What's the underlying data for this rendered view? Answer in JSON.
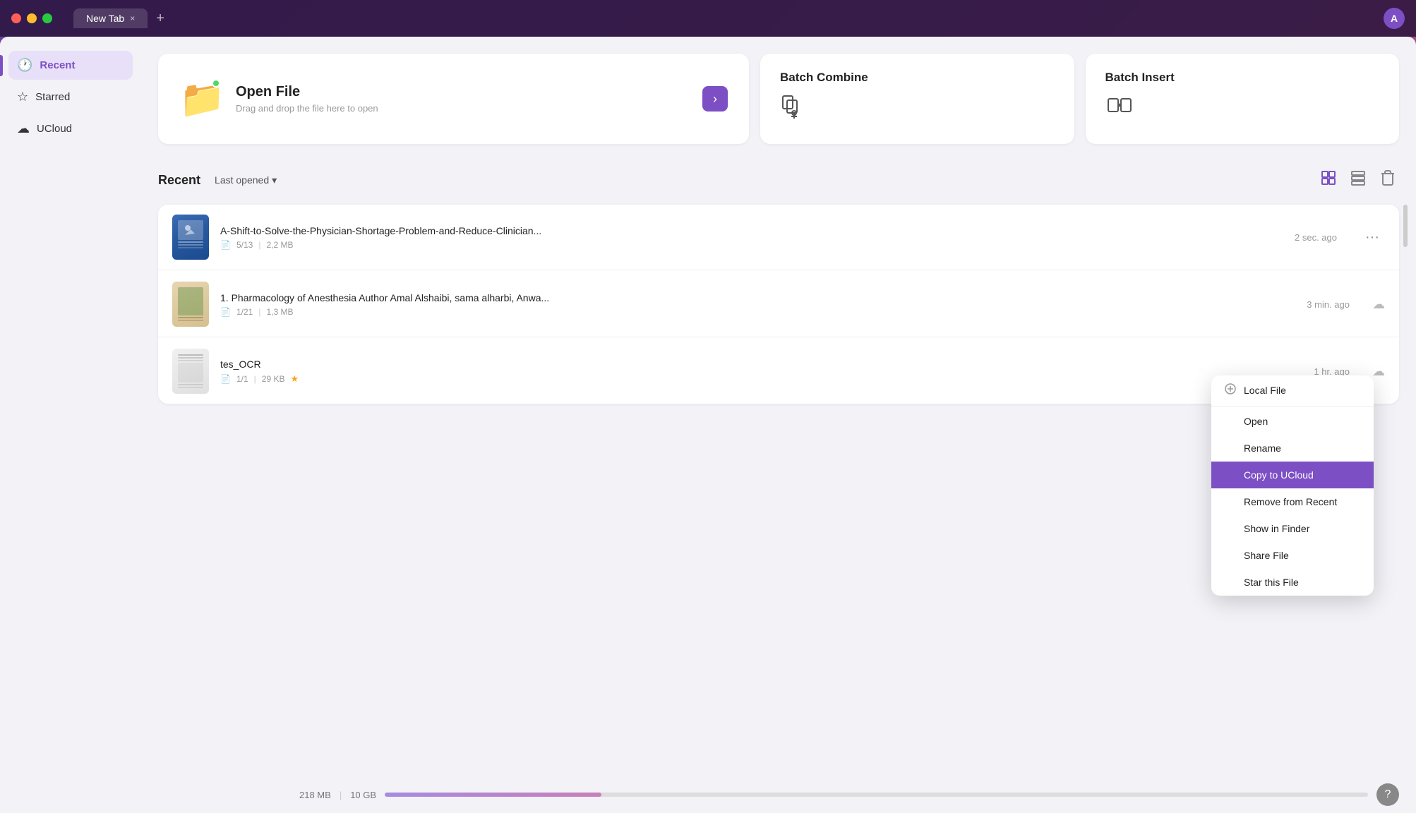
{
  "titleBar": {
    "tabLabel": "New Tab",
    "tabCloseIcon": "×",
    "tabAddIcon": "+",
    "avatarLabel": "A"
  },
  "sidebar": {
    "items": [
      {
        "id": "recent",
        "label": "Recent",
        "icon": "🕐",
        "active": true
      },
      {
        "id": "starred",
        "label": "Starred",
        "icon": "☆",
        "active": false
      },
      {
        "id": "ucloud",
        "label": "UCloud",
        "icon": "☁",
        "active": false
      }
    ]
  },
  "topCards": {
    "openFile": {
      "title": "Open File",
      "subtitle": "Drag and drop the file here to open",
      "arrowIcon": "›"
    },
    "batchCombine": {
      "title": "Batch Combine",
      "icon": "⊕"
    },
    "batchInsert": {
      "title": "Batch Insert",
      "icon": "⊞"
    }
  },
  "recentSection": {
    "title": "Recent",
    "sortLabel": "Last opened",
    "sortIcon": "▾",
    "viewGridIcon": "⊞",
    "viewListIcon": "▦",
    "trashIcon": "🗑"
  },
  "files": [
    {
      "id": "file1",
      "name": "A-Shift-to-Solve-the-Physician-Shortage-Problem-and-Reduce-Clinician...",
      "pages": "5/13",
      "size": "2,2 MB",
      "time": "2 sec. ago",
      "starred": false,
      "cloud": false,
      "thumbType": "pdf1"
    },
    {
      "id": "file2",
      "name": "1. Pharmacology of Anesthesia Author Amal Alshaibi, sama alharbi, Anwa...",
      "pages": "1/21",
      "size": "1,3 MB",
      "time": "3 min. ago",
      "starred": false,
      "cloud": true,
      "thumbType": "pdf2"
    },
    {
      "id": "file3",
      "name": "tes_OCR",
      "pages": "1/1",
      "size": "29 KB",
      "time": "1 hr. ago",
      "starred": true,
      "cloud": true,
      "thumbType": "pdf3"
    }
  ],
  "contextMenu": {
    "items": [
      {
        "id": "local-file",
        "label": "Local File",
        "icon": "📄",
        "dividerAfter": false
      },
      {
        "id": "open",
        "label": "Open",
        "icon": "",
        "dividerAfter": false
      },
      {
        "id": "rename",
        "label": "Rename",
        "icon": "",
        "dividerAfter": false
      },
      {
        "id": "copy-ucloud",
        "label": "Copy to UCloud",
        "icon": "",
        "dividerAfter": false,
        "highlighted": true
      },
      {
        "id": "remove-recent",
        "label": "Remove from Recent",
        "icon": "",
        "dividerAfter": false
      },
      {
        "id": "show-finder",
        "label": "Show in Finder",
        "icon": "",
        "dividerAfter": false
      },
      {
        "id": "share-file",
        "label": "Share File",
        "icon": "",
        "dividerAfter": false
      },
      {
        "id": "star-file",
        "label": "Star this File",
        "icon": "",
        "dividerAfter": false
      }
    ]
  },
  "bottomBar": {
    "storage": "218 MB",
    "separator": "|",
    "total": "10 GB",
    "helpIcon": "?",
    "fillPercent": 22
  }
}
